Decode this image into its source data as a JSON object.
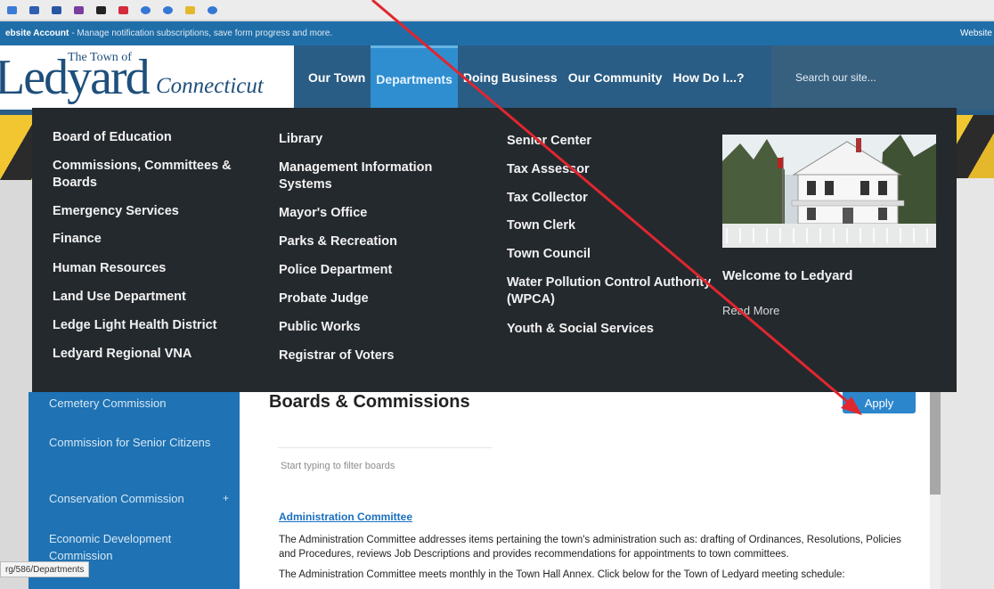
{
  "banner": {
    "bold": "ebsite Account",
    "text": "- Manage notification subscriptions, save form progress and more.",
    "right": "Website"
  },
  "logo": {
    "small": "The Town of",
    "big": "Ledyard",
    "state": "Connecticut"
  },
  "nav": [
    "Our Town",
    "Departments",
    "Doing Business",
    "Our Community",
    "How Do I...?"
  ],
  "search": {
    "placeholder": "Search our site..."
  },
  "menu": {
    "col1": [
      "Board of Education",
      "Commissions, Committees & Boards",
      "Emergency Services",
      "Finance",
      "Human Resources",
      "Land Use Department",
      "Ledge Light Health District",
      "Ledyard Regional VNA"
    ],
    "col2": [
      "Library",
      "Management Information Systems",
      "Mayor's Office",
      "Parks & Recreation",
      "Police Department",
      "Probate Judge",
      "Public Works",
      "Registrar of Voters"
    ],
    "col3": [
      "Senior Center",
      "Tax Assessor",
      "Tax Collector",
      "Town Clerk",
      "Town Council",
      "Water Pollution Control Authority (WPCA)",
      "Youth & Social Services"
    ],
    "welcome": "Welcome to Ledyard",
    "read_more": "Read More"
  },
  "sidebar": [
    "Cemetery Commission",
    "Commission for Senior Citizens",
    "Conservation Commission",
    "Economic Development Commission"
  ],
  "main": {
    "title": "Boards & Commissions",
    "apply": "Apply",
    "filter_placeholder": "Start typing to filter boards",
    "admin_link": "Administration Committee",
    "para1": "The Administration Committee addresses items pertaining the town's administration such as: drafting of Ordinances, Resolutions, Policies and Procedures, reviews Job Descriptions and provides recommendations for appointments to town committees.",
    "para2": "The Administration Committee meets monthly in the Town Hall Annex. Click below for the Town of Ledyard meeting schedule:"
  },
  "status_url": "rg/586/Departments",
  "colors": {
    "banner": "#1f6ea8",
    "nav_active": "#2f8ecf",
    "menu_bg": "#24292e",
    "sidebar": "#1f72b3",
    "arrow": "#e0262f"
  }
}
